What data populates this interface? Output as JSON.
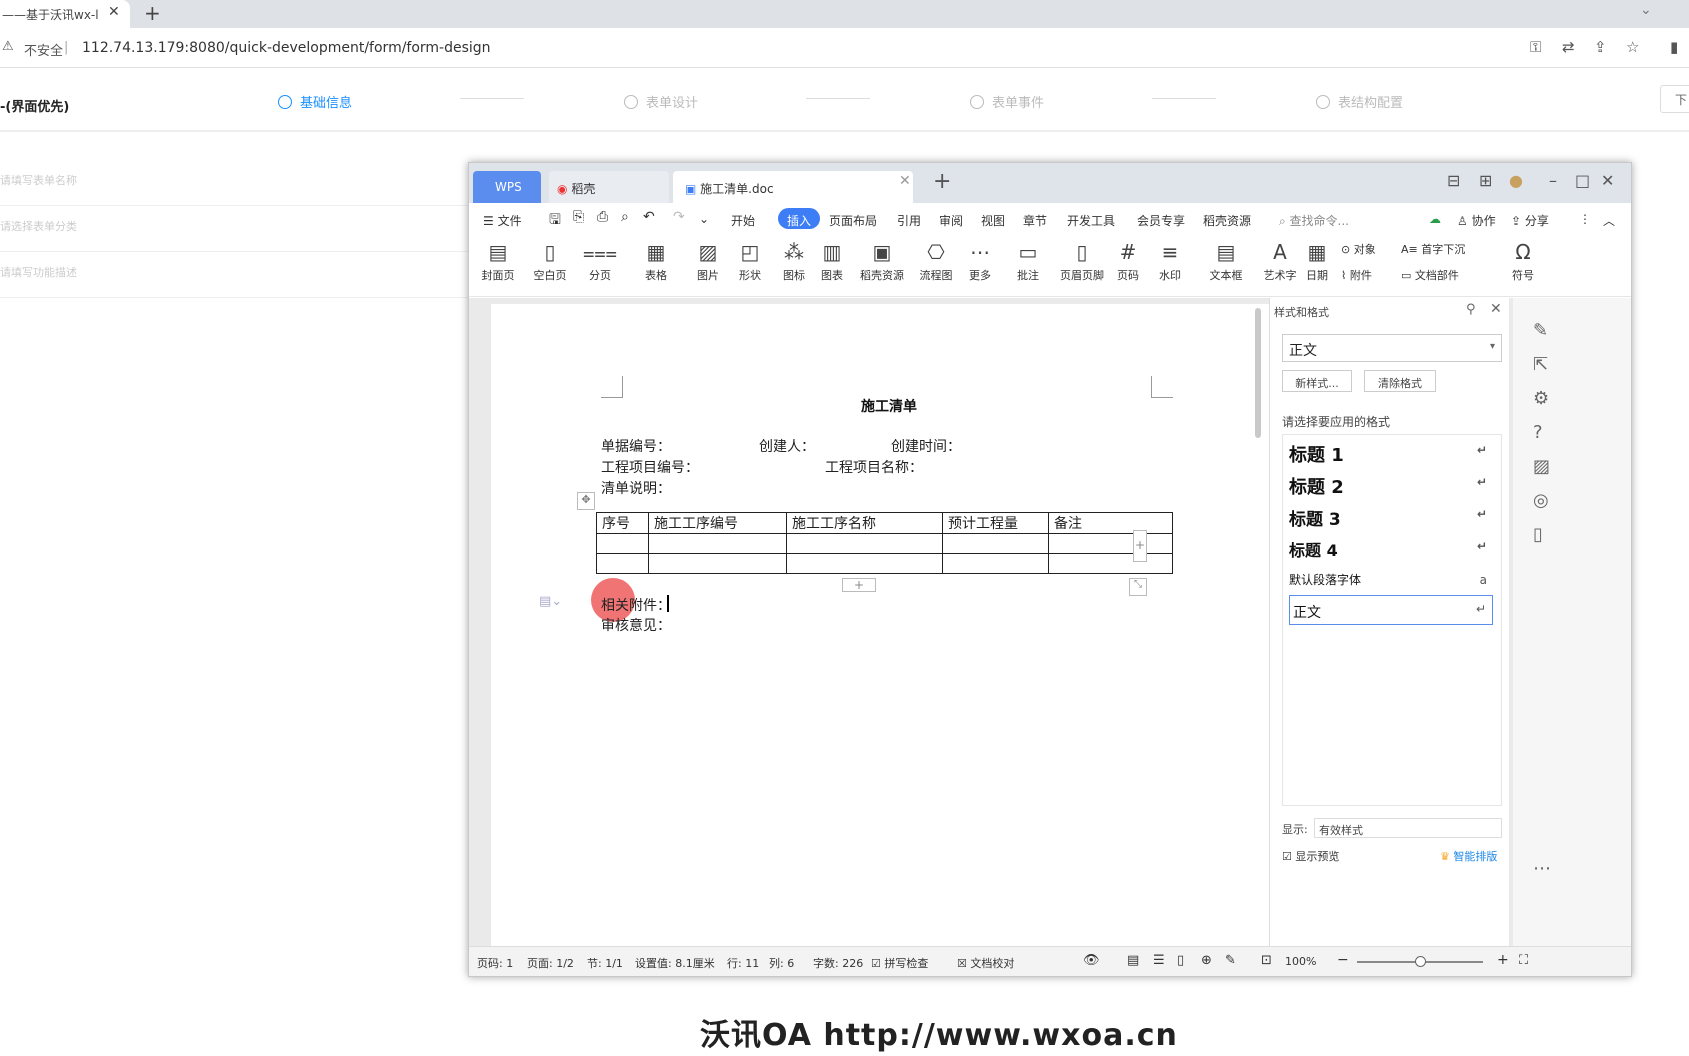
{
  "browser": {
    "tab_title": "——基于沃讯wx-l",
    "tab_close": "✕",
    "new_tab": "+",
    "insecure": "不安全",
    "url": "112.74.13.179:8080/quick-development/form/form-design"
  },
  "app": {
    "title": "-(界面优先)",
    "steps": [
      "基础信息",
      "表单设计",
      "表单事件",
      "表结构配置"
    ],
    "active_step": 0,
    "next_label": "下",
    "fields": [
      "请填写表单名称",
      "请选择表单分类",
      "请填写功能描述"
    ]
  },
  "wps": {
    "tabs": {
      "wps": "WPS",
      "dake": "稻壳",
      "doc": "施工清单.doc"
    },
    "menu": [
      "文件",
      "开始",
      "插入",
      "页面布局",
      "引用",
      "审阅",
      "视图",
      "章节",
      "开发工具",
      "会员专享",
      "稻壳资源"
    ],
    "search": "查找命令...",
    "collab": "协作",
    "share": "分享",
    "ribbon": [
      "封面页",
      "空白页",
      "分页",
      "表格",
      "图片",
      "形状",
      "图标",
      "图表",
      "稻壳资源",
      "流程图",
      "更多",
      "批注",
      "页眉页脚",
      "页码",
      "水印",
      "文本框",
      "艺术字",
      "日期",
      "对象",
      "附件",
      "首字下沉",
      "文档部件",
      "符号"
    ],
    "document": {
      "title": "施工清单",
      "line1": {
        "a": "单据编号：",
        "b": "创建人：",
        "c": "创建时间："
      },
      "line2": {
        "a": "工程项目编号：",
        "b": "工程项目名称："
      },
      "line3": "清单说明：",
      "table_headers": [
        "序号",
        "施工工序编号",
        "施工工序名称",
        "预计工程量",
        "备注"
      ],
      "after1": "相关附件：",
      "after2": "审核意见："
    },
    "styles_panel": {
      "title": "样式和格式",
      "current": "正文",
      "new_style": "新样式...",
      "clear_format": "清除格式",
      "apply_label": "请选择要应用的格式",
      "styles": [
        "标题 1",
        "标题 2",
        "标题 3",
        "标题 4",
        "默认段落字体",
        "正文"
      ],
      "show_label": "显示:",
      "show_value": "有效样式",
      "preview_label": "显示预览",
      "smart": "智能排版"
    },
    "status": {
      "page": "页码: 1",
      "pages": "页面: 1/2",
      "section": "节: 1/1",
      "setting": "设置值: 8.1厘米",
      "row": "行: 11",
      "col": "列: 6",
      "words": "字数: 226",
      "spell": "拼写检查",
      "proof": "文档校对",
      "zoom": "100%"
    }
  },
  "watermark": "沃讯OA   http://www.wxoa.cn",
  "colors": {
    "accent": "#1890ff",
    "wps_blue": "#3d7df5"
  }
}
